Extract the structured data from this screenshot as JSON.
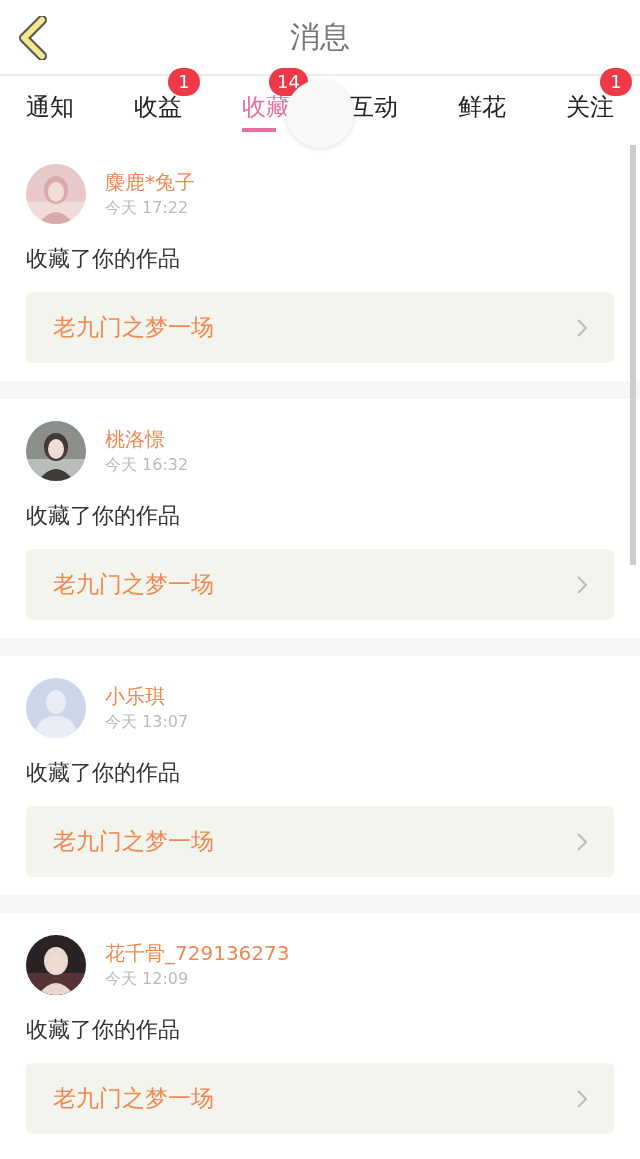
{
  "header": {
    "title": "消息"
  },
  "tabs": [
    {
      "label": "通知",
      "selected": false
    },
    {
      "label": "收益",
      "selected": false,
      "badge": "1"
    },
    {
      "label": "收藏",
      "selected": true,
      "badge": "14"
    },
    {
      "label": "互动",
      "selected": false
    },
    {
      "label": "鲜花",
      "selected": false
    },
    {
      "label": "关注",
      "selected": false,
      "badge": "1"
    }
  ],
  "messages": [
    {
      "name": "麋鹿*兔子",
      "time": "今天 17:22",
      "text": "收藏了你的作品",
      "work": "老九门之梦一场"
    },
    {
      "name": "桃洛憬",
      "time": "今天 16:32",
      "text": "收藏了你的作品",
      "work": "老九门之梦一场"
    },
    {
      "avatar": {
        "kind": "default"
      },
      "name": "小乐琪",
      "time": "今天 13:07",
      "text": "收藏了你的作品",
      "work": "老九门之梦一场"
    },
    {
      "name": "花千骨_729136273",
      "time": "今天 12:09",
      "text": "收藏了你的作品",
      "work": "老九门之梦一场"
    }
  ]
}
